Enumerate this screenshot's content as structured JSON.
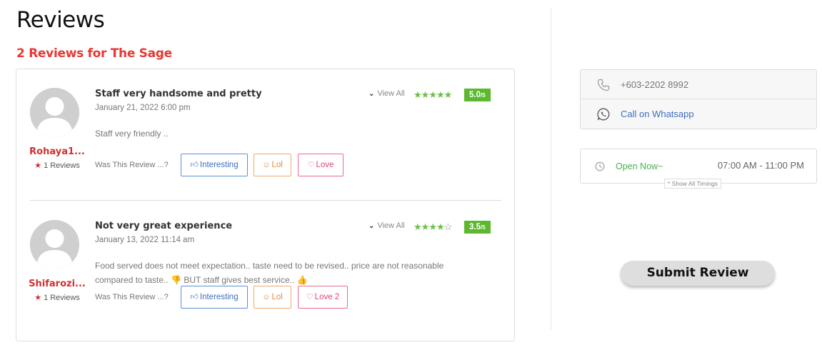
{
  "page": {
    "title": "Reviews",
    "reviews_heading": "2 Reviews for The Sage"
  },
  "reviews": [
    {
      "reviewer_name": "Rohaya1...",
      "reviewer_review_count": "1 Reviews",
      "title": "Staff very handsome and pretty",
      "date": "January 21, 2022 6:00 pm",
      "body": "Staff very friendly ..",
      "view_all_label": "View All",
      "stars_filled": 5,
      "stars_total": 5,
      "rating": "5.0",
      "rating_max": "/5",
      "was_this_label": "Was This Review ...?",
      "interesting_label": "Interesting",
      "lol_label": "Lol",
      "love_label": "Love"
    },
    {
      "reviewer_name": "Shifarozi...",
      "reviewer_review_count": "1 Reviews",
      "title": "Not very great experience",
      "date": "January 13, 2022 11:14 am",
      "body": "Food served does not meet expectation.. taste need to be revised.. price are not reasonable compared to taste.. 👎 BUT staff gives best service.. 👍",
      "view_all_label": "View All",
      "stars_filled": 4,
      "stars_total": 5,
      "rating": "3.5",
      "rating_max": "/5",
      "was_this_label": "Was This Review ...?",
      "interesting_label": "Interesting",
      "lol_label": "Lol",
      "love_label": "Love 2"
    }
  ],
  "contact": {
    "phone": "+603-2202 8992",
    "whatsapp_label": "Call on Whatsapp"
  },
  "hours": {
    "status": "Open Now~",
    "range": "07:00 AM - 11:00 PM",
    "show_all_label": "* Show All Timings"
  },
  "actions": {
    "submit_review_label": "Submit Review"
  },
  "colors": {
    "accent_red": "#e53935",
    "rating_green": "#5cb82e",
    "link_blue": "#3f6fbf"
  },
  "icons": {
    "avatar": "default-user-avatar-icon",
    "reviewer_star": "star-icon",
    "view_all_chevron": "chevron-down-icon",
    "interesting": "thumbs-up-icon",
    "lol": "smiley-icon",
    "love": "heart-icon",
    "phone": "phone-icon",
    "whatsapp": "whatsapp-icon",
    "clock": "clock-icon"
  }
}
